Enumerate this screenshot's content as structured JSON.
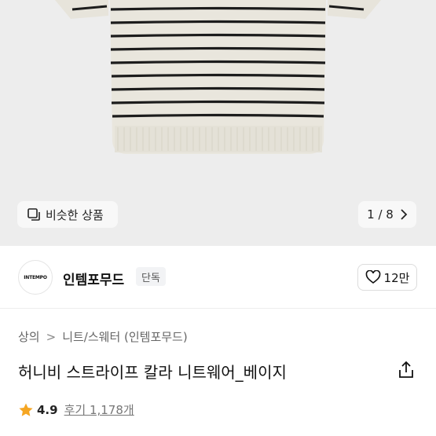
{
  "product_image": {
    "similar_label": "비슷한 상품",
    "page_indicator": "1 / 8"
  },
  "brand": {
    "logo_text": "INTEMPO",
    "name": "인템포무드",
    "badge": "단독",
    "like_count": "12만"
  },
  "breadcrumb": {
    "category": "상의",
    "separator": ">",
    "subcategory": "니트/스웨터 (인템포무드)"
  },
  "product": {
    "title": "허니비 스트라이프 칼라 니트웨어_베이지",
    "rating": "4.9",
    "reviews": "후기 1,178개"
  },
  "colors": {
    "star": "#f5a623",
    "sweater_base": "#e9e6dd",
    "stripe": "#1c1c1c"
  }
}
